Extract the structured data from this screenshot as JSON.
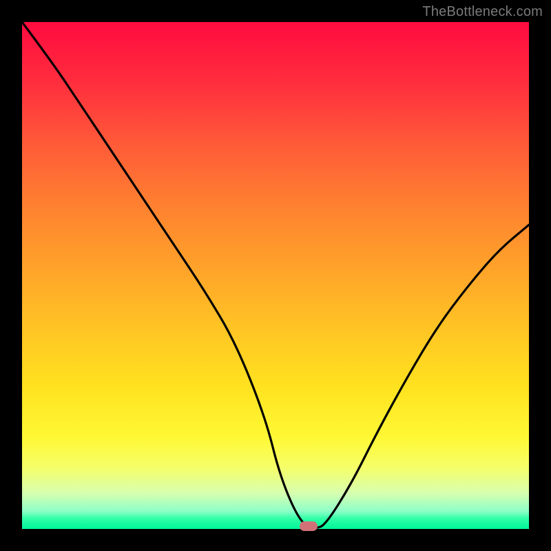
{
  "watermark": "TheBottleneck.com",
  "colors": {
    "frame_bg": "#000000",
    "curve": "#000000",
    "marker": "#d17077"
  },
  "chart_data": {
    "type": "line",
    "title": "",
    "xlabel": "",
    "ylabel": "",
    "xlim": [
      0,
      100
    ],
    "ylim": [
      0,
      100
    ],
    "series": [
      {
        "name": "bottleneck-curve",
        "x": [
          0,
          6,
          12,
          18,
          24,
          30,
          36,
          42,
          48,
          51,
          55,
          58,
          60,
          65,
          70,
          76,
          82,
          88,
          94,
          100
        ],
        "values": [
          100,
          92,
          83,
          74,
          65,
          56,
          47,
          37,
          22,
          10,
          1,
          0,
          1,
          9,
          19,
          30,
          40,
          48,
          55,
          60
        ]
      }
    ],
    "annotations": [
      {
        "name": "optimal-marker",
        "x": 56.5,
        "y": 0
      }
    ],
    "background_gradient": {
      "type": "vertical",
      "stops": [
        {
          "pos": 0.0,
          "color": "#ff0b3f"
        },
        {
          "pos": 0.5,
          "color": "#ffa12a"
        },
        {
          "pos": 0.85,
          "color": "#fff835"
        },
        {
          "pos": 1.0,
          "color": "#00f59a"
        }
      ]
    }
  }
}
